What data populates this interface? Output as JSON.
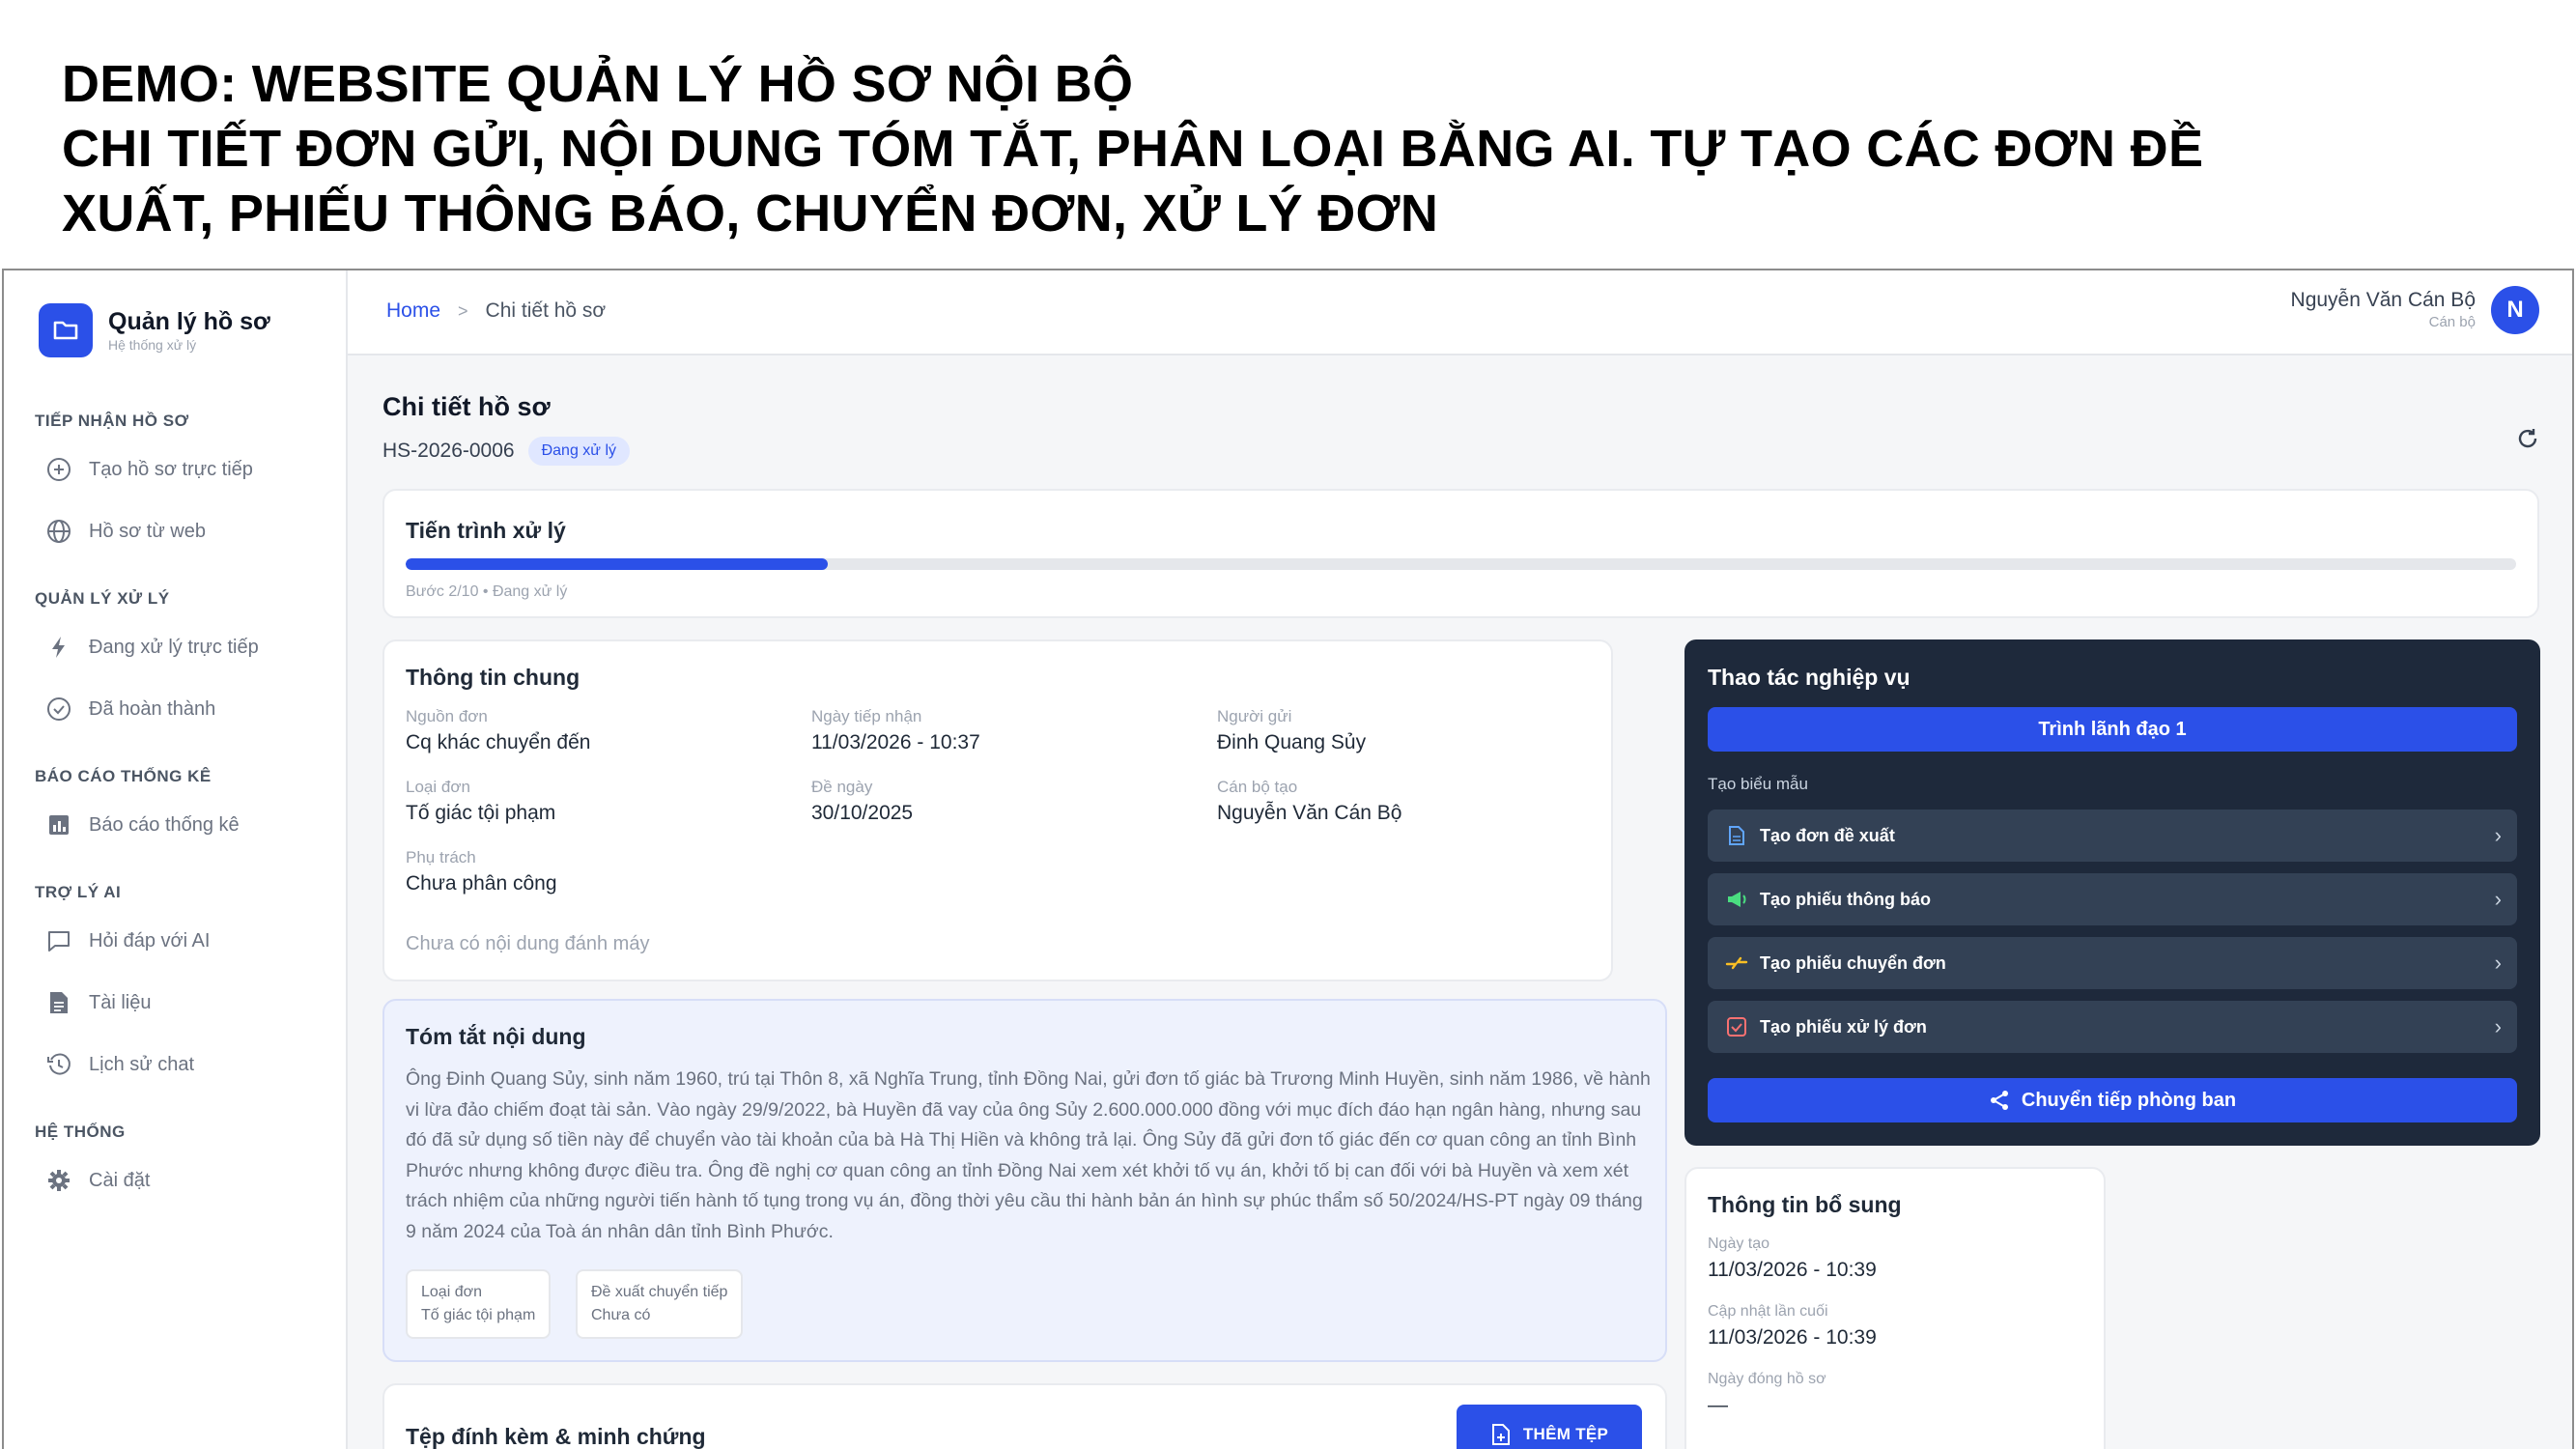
{
  "slide": {
    "title_lines": [
      "DEMO: WEBSITE QUẢN LÝ HỒ SƠ NỘI BỘ",
      "CHI TIẾT ĐƠN GỬI, NỘI DUNG TÓM TẮT, PHÂN LOẠI BẰNG AI. TỰ TẠO CÁC ĐƠN ĐỀ",
      "XUẤT, PHIẾU THÔNG BÁO, CHUYỂN ĐƠN, XỬ LÝ ĐƠN"
    ]
  },
  "brand": {
    "name": "Quản lý hồ sơ",
    "subtitle": "Hệ thống xử lý"
  },
  "sidebar": {
    "sections": [
      {
        "title": "TIẾP NHẬN HỒ SƠ",
        "items": [
          {
            "label": "Tạo hồ sơ trực tiếp",
            "icon": "plus-circle-icon"
          },
          {
            "label": "Hồ sơ từ web",
            "icon": "globe-icon"
          }
        ]
      },
      {
        "title": "QUẢN LÝ XỬ LÝ",
        "items": [
          {
            "label": "Đang xử lý trực tiếp",
            "icon": "lightning-icon"
          },
          {
            "label": "Đã hoàn thành",
            "icon": "check-circle-icon"
          }
        ]
      },
      {
        "title": "BÁO CÁO THỐNG KÊ",
        "items": [
          {
            "label": "Báo cáo thống kê",
            "icon": "bar-chart-icon"
          }
        ]
      },
      {
        "title": "TRỢ LÝ AI",
        "items": [
          {
            "label": "Hỏi đáp với AI",
            "icon": "chat-icon"
          },
          {
            "label": "Tài liệu",
            "icon": "document-icon"
          },
          {
            "label": "Lịch sử chat",
            "icon": "history-icon"
          }
        ]
      },
      {
        "title": "HỆ THỐNG",
        "items": [
          {
            "label": "Cài đặt",
            "icon": "gear-icon"
          }
        ]
      }
    ]
  },
  "topbar": {
    "breadcrumb": {
      "home": "Home",
      "separator": ">",
      "current": "Chi tiết hồ sơ"
    },
    "user": {
      "name": "Nguyễn Văn Cán Bộ",
      "role": "Cán bộ",
      "initial": "N"
    }
  },
  "page": {
    "title": "Chi tiết hồ sơ",
    "case_code": "HS-2026-0006",
    "status": "Đang xử lý"
  },
  "progress": {
    "title": "Tiến trình xử lý",
    "step": 2,
    "total": 10,
    "label": "Bước 2/10 • Đang xử lý"
  },
  "general_info": {
    "title": "Thông tin chung",
    "fields": {
      "source": {
        "label": "Nguồn đơn",
        "value": "Cq khác chuyển đến"
      },
      "received": {
        "label": "Ngày tiếp nhận",
        "value": "11/03/2026 - 10:37"
      },
      "sender": {
        "label": "Người gửi",
        "value": "Đinh Quang Sủy"
      },
      "type": {
        "label": "Loại đơn",
        "value": "Tố giác tội phạm"
      },
      "submitted": {
        "label": "Đề ngày",
        "value": "30/10/2025"
      },
      "creator": {
        "label": "Cán bộ tạo",
        "value": "Nguyễn Văn Cán Bộ"
      },
      "assignee": {
        "label": "Phụ trách",
        "value": "Chưa phân công"
      }
    },
    "no_typed_content": "Chưa có nội dung đánh máy"
  },
  "summary": {
    "title": "Tóm tắt nội dung",
    "text": "Ông Đinh Quang Sủy, sinh năm 1960, trú tại Thôn 8, xã Nghĩa Trung, tỉnh Đồng Nai, gửi đơn tố giác bà Trương Minh Huyền, sinh năm 1986, về hành vi lừa đảo chiếm đoạt tài sản. Vào ngày 29/9/2022, bà Huyền đã vay của ông Sủy 2.600.000.000 đồng với mục đích đáo hạn ngân hàng, nhưng sau đó đã sử dụng số tiền này để chuyển vào tài khoản của bà Hà Thị Hiền và không trả lại. Ông Sủy đã gửi đơn tố giác đến cơ quan công an tỉnh Bình Phước nhưng không được điều tra. Ông đề nghị cơ quan công an tỉnh Đồng Nai xem xét khởi tố vụ án, khởi tố bị can đối với bà Huyền và xem xét trách nhiệm của những người tiến hành tố tụng trong vụ án, đồng thời yêu cầu thi hành bản án hình sự phúc thẩm số 50/2024/HS-PT ngày 09 tháng 9 năm 2024 của Toà án nhân dân tỉnh Bình Phước.",
    "chips": [
      {
        "label": "Loại đơn",
        "value": "Tố giác tội phạm"
      },
      {
        "label": "Đề xuất chuyển tiếp",
        "value": "Chưa có"
      }
    ]
  },
  "attachments": {
    "title": "Tệp đính kèm & minh chứng",
    "add_label": "THÊM TỆP"
  },
  "actions": {
    "title": "Thao tác nghiệp vụ",
    "submit_label": "Trình lãnh đạo 1",
    "forms_label": "Tạo biểu mẫu",
    "forms": [
      {
        "label": "Tạo đơn đề xuất",
        "icon": "file-icon",
        "color": "#60a5fa"
      },
      {
        "label": "Tạo phiếu thông báo",
        "icon": "megaphone-icon",
        "color": "#4ade80"
      },
      {
        "label": "Tạo phiếu chuyển đơn",
        "icon": "transfer-icon",
        "color": "#fbbf24"
      },
      {
        "label": "Tạo phiếu xử lý đơn",
        "icon": "checkbox-icon",
        "color": "#f87171"
      }
    ],
    "forward_label": "Chuyển tiếp phòng ban"
  },
  "extra_info": {
    "title": "Thông tin bổ sung",
    "created": {
      "label": "Ngày tạo",
      "value": "11/03/2026 - 10:39"
    },
    "updated": {
      "label": "Cập nhật lần cuối",
      "value": "11/03/2026 - 10:39"
    },
    "closed": {
      "label": "Ngày đóng hồ sơ",
      "value": "—"
    }
  },
  "colors": {
    "accent": "#2b50e8",
    "panel_dark": "#1e293b",
    "summary_bg": "#eef2fd"
  }
}
